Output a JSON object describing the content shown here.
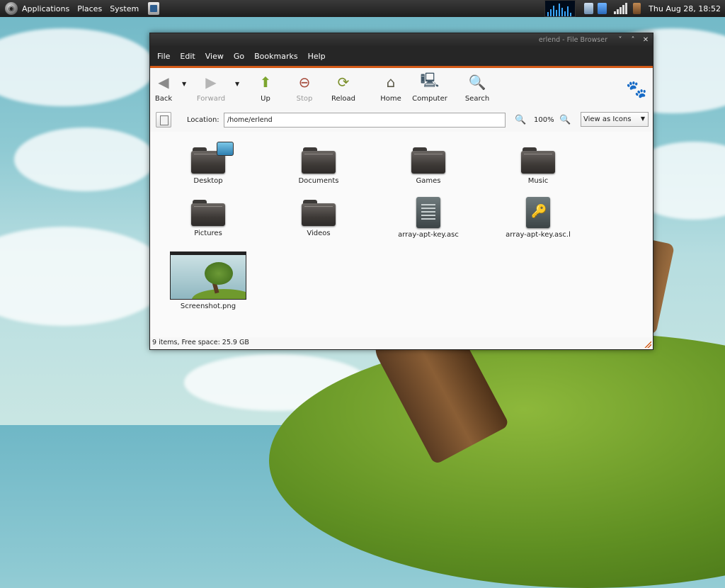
{
  "panel": {
    "menus": [
      "Applications",
      "Places",
      "System"
    ],
    "clock": "Thu Aug 28, 18:52",
    "icons": [
      "gnome-logo-icon",
      "launcher-icon",
      "system-monitor-icon",
      "battery-icon",
      "network-icon",
      "signal-icon",
      "user-icon"
    ]
  },
  "window": {
    "title": "erlend - File Browser",
    "controls": [
      "minimize",
      "maximize",
      "close"
    ]
  },
  "menubar": {
    "items": [
      {
        "label": "File",
        "mnemonic": "F"
      },
      {
        "label": "Edit",
        "mnemonic": "E"
      },
      {
        "label": "View",
        "mnemonic": "V"
      },
      {
        "label": "Go",
        "mnemonic": "G"
      },
      {
        "label": "Bookmarks",
        "mnemonic": "B"
      },
      {
        "label": "Help",
        "mnemonic": "H"
      }
    ]
  },
  "toolbar": {
    "back": "Back",
    "forward": "Forward",
    "up": "Up",
    "stop": "Stop",
    "reload": "Reload",
    "home": "Home",
    "computer": "Computer",
    "search": "Search"
  },
  "location": {
    "label": "Location:",
    "value": "/home/erlend",
    "zoom": "100%",
    "view_mode": "View as Icons"
  },
  "files": [
    {
      "name": "Desktop",
      "type": "folder"
    },
    {
      "name": "Documents",
      "type": "folder"
    },
    {
      "name": "Games",
      "type": "folder"
    },
    {
      "name": "Music",
      "type": "folder"
    },
    {
      "name": "Pictures",
      "type": "folder"
    },
    {
      "name": "Videos",
      "type": "folder"
    },
    {
      "name": "array-apt-key.asc",
      "type": "text"
    },
    {
      "name": "array-apt-key.asc.l",
      "type": "key"
    },
    {
      "name": "Screenshot.png",
      "type": "image"
    }
  ],
  "status": {
    "text": "9 items, Free space: 25.9 GB"
  },
  "colors": {
    "accent": "#d45a17",
    "menubar_bg": "#262626"
  }
}
